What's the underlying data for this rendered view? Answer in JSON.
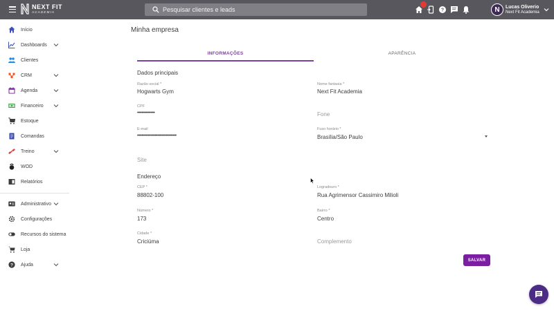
{
  "header": {
    "brand_top": "NEXT FIT",
    "brand_bottom": "ACADEMIA",
    "search_placeholder": "Pesquisar clientes e leads",
    "user_name": "Lucas Oliverio",
    "user_company": "Next Fit Academia",
    "avatar_letter": "N",
    "icons": [
      "home-icon",
      "mobile-icon",
      "help-icon",
      "chat-icon",
      "bell-icon"
    ]
  },
  "sidebar": {
    "items": [
      {
        "label": "Início",
        "icon": "home-icon",
        "color": "#3f51b5"
      },
      {
        "label": "Dashboards",
        "icon": "chart-icon",
        "color": "#3f51b5",
        "expandable": true
      },
      {
        "label": "Clientes",
        "icon": "people-icon",
        "color": "#1e88e5"
      },
      {
        "label": "CRM",
        "icon": "crm-icon",
        "color": "#f4511e",
        "expandable": true
      },
      {
        "label": "Agenda",
        "icon": "calendar-icon",
        "color": "#7b1fa2",
        "expandable": true
      },
      {
        "label": "Financeiro",
        "icon": "money-icon",
        "color": "#43a047",
        "expandable": true
      },
      {
        "label": "Estoque",
        "icon": "cart-icon",
        "color": "#3c3c3c"
      },
      {
        "label": "Comandas",
        "icon": "receipt-icon",
        "color": "#3949ab"
      },
      {
        "label": "Treino",
        "icon": "dumbbell-icon",
        "color": "#e53935",
        "expandable": true
      },
      {
        "label": "WOD",
        "icon": "kettlebell-icon",
        "color": "#212121"
      },
      {
        "label": "Relatórios",
        "icon": "report-icon",
        "color": "#3c3c3c"
      },
      {
        "label": "Administrativo",
        "icon": "admin-icon",
        "color": "#3c3c3c",
        "expandable": true
      },
      {
        "label": "Configurações",
        "icon": "gear-icon",
        "color": "#3c3c3c"
      },
      {
        "label": "Recursos do sistema",
        "icon": "toggle-icon",
        "color": "#3c3c3c"
      },
      {
        "label": "Loja",
        "icon": "shop-icon",
        "color": "#3c3c3c"
      },
      {
        "label": "Ajuda",
        "icon": "help-icon",
        "color": "#3c3c3c",
        "expandable": true
      }
    ]
  },
  "main": {
    "title": "Minha empresa",
    "tabs": [
      {
        "label": "INFORMAÇÕES",
        "active": true
      },
      {
        "label": "APARÊNCIA",
        "active": false
      }
    ],
    "section_main": "Dados principais",
    "section_address": "Endereço",
    "fields": {
      "razao_label": "Razão social *",
      "razao_value": "Hogwarts Gym",
      "fantasia_label": "Nome fantasia *",
      "fantasia_value": "Next Fit Academia",
      "cpf_label": "CPF",
      "cpf_value": "•••••••••••••",
      "fone_placeholder": "Fone",
      "email_label": "E-mail",
      "email_value": "•••••••••••••••••••••••••••••",
      "fuso_label": "Fuso horário *",
      "fuso_value": "Brasília/São Paulo",
      "site_placeholder": "Site",
      "cep_label": "CEP *",
      "cep_value": "88802-100",
      "logradouro_label": "Logradouro *",
      "logradouro_value": "Rua Agrimensor Cassimiro Milioli",
      "numero_label": "Número *",
      "numero_value": "173",
      "bairro_label": "Bairro *",
      "bairro_value": "Centro",
      "cidade_label": "Cidade *",
      "cidade_value": "Criciúma",
      "complemento_placeholder": "Complemento"
    },
    "save_label": "SALVAR"
  },
  "colors": {
    "accent": "#7b1fa2",
    "topbar": "#58575d",
    "chat_fab": "#4b2d86",
    "badge": "#e53935"
  }
}
